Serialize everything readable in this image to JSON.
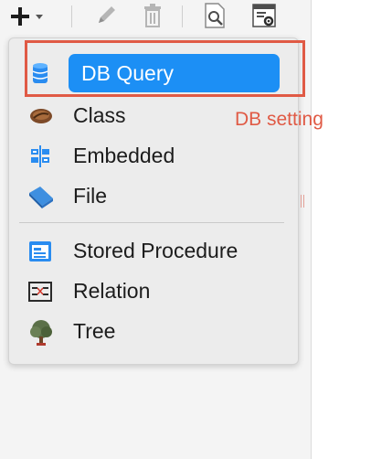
{
  "toolbar": {
    "add_button_icon": "plus-icon",
    "add_dropdown_icon": "chevron-down-icon",
    "edit_button_icon": "pencil-icon",
    "delete_button_icon": "trash-icon",
    "preview_button_icon": "page-search-icon",
    "settings_button_icon": "page-gear-icon"
  },
  "menu": {
    "items": [
      {
        "label": "DB Query",
        "icon": "database-icon",
        "active": true
      },
      {
        "label": "Class",
        "icon": "class-bean-icon",
        "active": false
      },
      {
        "label": "Embedded",
        "icon": "embedded-icon",
        "active": false
      },
      {
        "label": "File",
        "icon": "file-icon",
        "active": false
      }
    ],
    "items2": [
      {
        "label": "Stored Procedure",
        "icon": "stored-procedure-icon",
        "active": false
      },
      {
        "label": "Relation",
        "icon": "relation-icon",
        "active": false
      },
      {
        "label": "Tree",
        "icon": "tree-icon",
        "active": false
      }
    ]
  },
  "annotation": {
    "label": "DB setting",
    "color": "#e05a45"
  },
  "colors": {
    "accent": "#1c8ff5",
    "menu_background": "#ececec"
  }
}
